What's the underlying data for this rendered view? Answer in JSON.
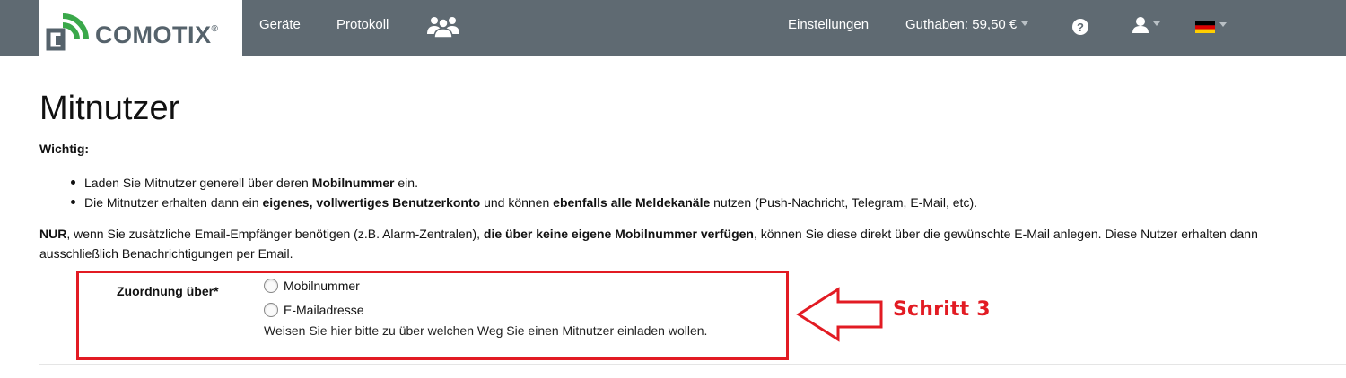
{
  "brand": {
    "logo_text": "COMOTIX",
    "registered": "®"
  },
  "nav": {
    "devices": "Geräte",
    "log": "Protokoll",
    "users_icon": "users-group-icon",
    "settings": "Einstellungen",
    "balance": "Guthaben: 59,50 €",
    "help_icon": "question-circle-icon",
    "user_icon": "user-icon",
    "language_icon": "german-flag-icon"
  },
  "page": {
    "title": "Mitnutzer",
    "important_label": "Wichtig:",
    "bullets": [
      {
        "pre": "Laden Sie Mitnutzer generell über deren ",
        "bold": "Mobilnummer",
        "post": " ein."
      },
      {
        "pre": "Die Mitnutzer erhalten dann ein ",
        "bold1": "eigenes, vollwertiges Benutzerkonto",
        "mid": " und können ",
        "bold2": "ebenfalls alle Meldekanäle",
        "post": " nutzen (Push-Nachricht, Telegram, E-Mail, etc)."
      }
    ],
    "paragraph": {
      "bold1": "NUR",
      "text1": ", wenn Sie zusätzliche Email-Empfänger benötigen (z.B. Alarm-Zentralen), ",
      "bold2": "die über keine eigene Mobilnummer verfügen",
      "text2": ", können Sie diese direkt über die gewünschte E-Mail anlegen. Diese Nutzer erhalten dann ausschließlich Benachrichtigungen per Email."
    }
  },
  "form": {
    "label": "Zuordnung über*",
    "options": [
      "Mobilnummer",
      "E-Mailadresse"
    ],
    "selected": null,
    "help": "Weisen Sie hier bitte zu über welchen Weg Sie einen Mitnutzer einladen wollen."
  },
  "annotation": {
    "text": "Schritt 3",
    "color": "#e21b23"
  },
  "colors": {
    "navbar": "#5f6a72",
    "annotation_red": "#e21b23",
    "logo_green": "#3aa84a",
    "logo_gray": "#55626b"
  }
}
